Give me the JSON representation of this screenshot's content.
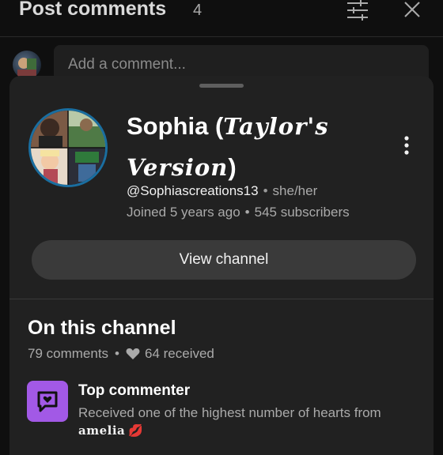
{
  "header": {
    "title": "Post comments",
    "count": "4",
    "filter_icon": "filter-sliders-icon",
    "close_icon": "close-icon"
  },
  "comment_box": {
    "placeholder": "Add a comment..."
  },
  "channel_card": {
    "name_prefix": "Sophia (",
    "name_italic": "Taylor's Version",
    "name_suffix": ")",
    "handle": "@Sophiascreations13",
    "pronouns": "she/her",
    "joined": "Joined 5 years ago",
    "subscribers": "545 subscribers",
    "separator": "•",
    "view_channel_label": "View channel",
    "more_icon": "more-vertical-icon",
    "ring_color": "#1a6ea0"
  },
  "on_channel": {
    "title": "On this channel",
    "comments": "79 comments",
    "received": "64 received",
    "heart_icon": "heart-icon"
  },
  "top_commenter": {
    "title": "Top commenter",
    "description": "Received one of the highest number of hearts from",
    "from_user": "amelia",
    "emoji": "💋",
    "badge_color": "#a259e6",
    "badge_icon": "heart-chat-icon"
  }
}
